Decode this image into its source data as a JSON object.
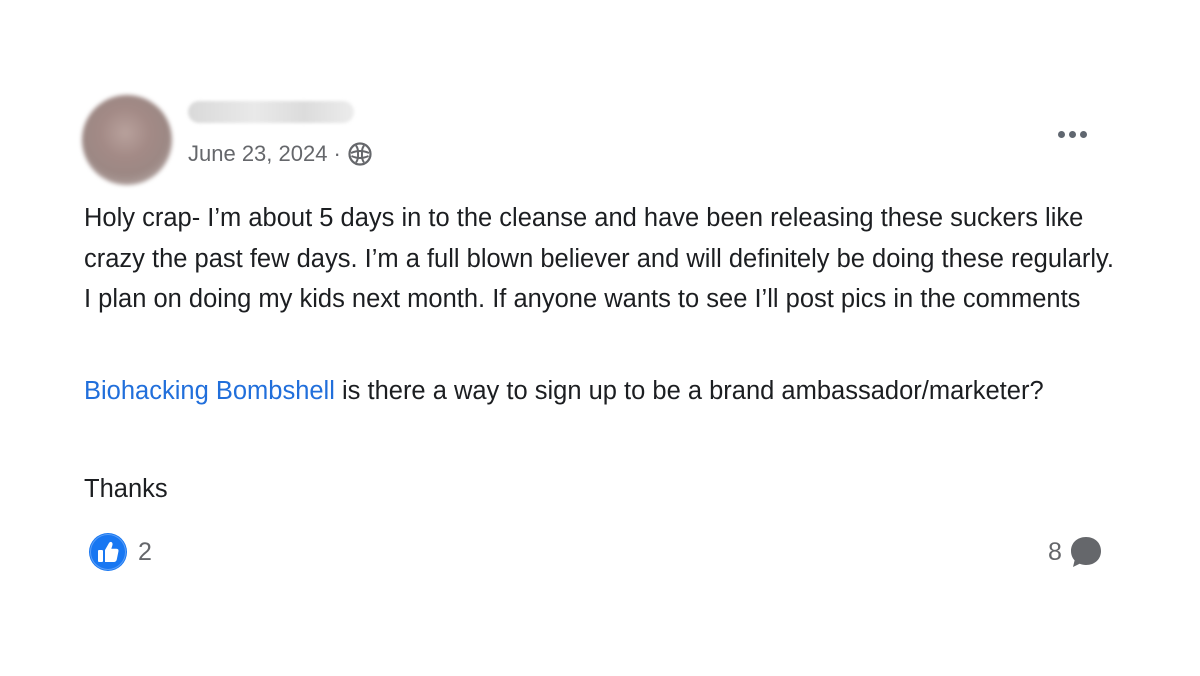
{
  "post": {
    "date": "June 23, 2024",
    "separator": "·",
    "privacy_icon": "globe-icon",
    "more_icon": "more-options-icon",
    "paragraph1": "Holy crap- I’m about 5 days in to the cleanse and have been releasing these suckers like crazy the past few days. I’m a full blown believer and will definitely be doing these regularly. I plan on doing my kids next month.  If anyone wants to see I’ll post pics in the comments",
    "mention": "Biohacking Bombshell",
    "paragraph2_rest": " is there a way to sign up to be a brand ambassador/marketer?",
    "paragraph3": "Thanks"
  },
  "footer": {
    "reaction_icon": "like-icon",
    "reaction_count": "2",
    "comment_count": "8",
    "comment_icon": "comment-bubble-icon"
  },
  "colors": {
    "text": "#1c1e21",
    "secondary": "#65676b",
    "mention": "#216fdb",
    "like_blue": "#1877f2"
  }
}
